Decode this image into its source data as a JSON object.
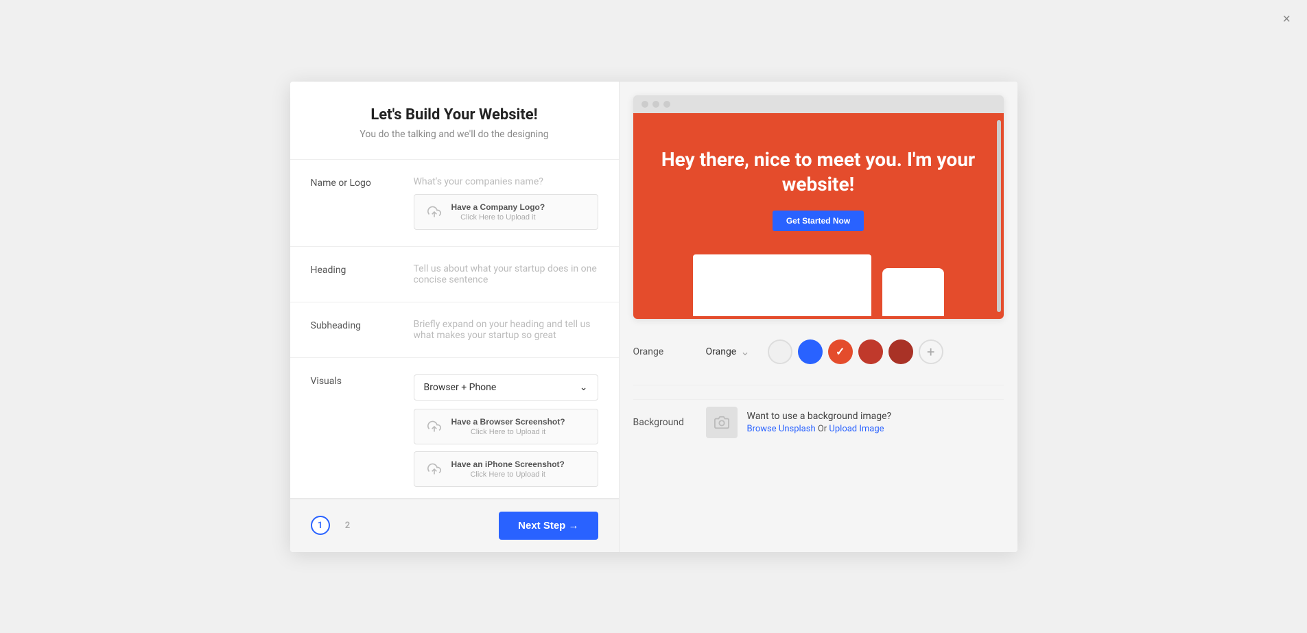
{
  "close_button": "×",
  "left_panel": {
    "header": {
      "title": "Let's Build Your Website!",
      "subtitle": "You do the talking and we'll do the designing"
    },
    "rows": [
      {
        "id": "name-or-logo",
        "label": "Name or Logo",
        "placeholder": "What's your companies name?",
        "upload": {
          "title": "Have a Company Logo?",
          "subtitle": "Click Here to Upload it"
        }
      },
      {
        "id": "heading",
        "label": "Heading",
        "placeholder": "Tell us about what your startup does in one concise sentence"
      },
      {
        "id": "subheading",
        "label": "Subheading",
        "placeholder": "Briefly expand on your heading and tell us what makes your startup so great"
      },
      {
        "id": "visuals",
        "label": "Visuals",
        "dropdown_value": "Browser + Phone",
        "upload1": {
          "title": "Have a Browser Screenshot?",
          "subtitle": "Click Here to Upload it"
        },
        "upload2": {
          "title": "Have an iPhone Screenshot?",
          "subtitle": "Click Here to Upload it"
        }
      }
    ],
    "footer": {
      "page1_label": "1",
      "page2_label": "2",
      "next_button": "Next Step →"
    }
  },
  "right_panel": {
    "browser_preview": {
      "hero_title": "Hey there, nice to meet you. I'm your website!",
      "cta_button": "Get Started Now"
    },
    "color_section": {
      "label": "Orange",
      "swatches": [
        {
          "id": "white",
          "color": "#f5f5f5",
          "selected": false
        },
        {
          "id": "blue",
          "color": "#2962ff",
          "selected": false
        },
        {
          "id": "orange-check",
          "color": "#e44c2c",
          "selected": true
        },
        {
          "id": "orange-dark",
          "color": "#c0392b",
          "selected": false
        },
        {
          "id": "red-dark",
          "color": "#b03020",
          "selected": false
        }
      ]
    },
    "background_section": {
      "label": "Background",
      "prompt": "Want to use a background image?",
      "browse_link": "Browse Unsplash",
      "or_text": "  Or  ",
      "upload_link": "Upload Image"
    }
  }
}
